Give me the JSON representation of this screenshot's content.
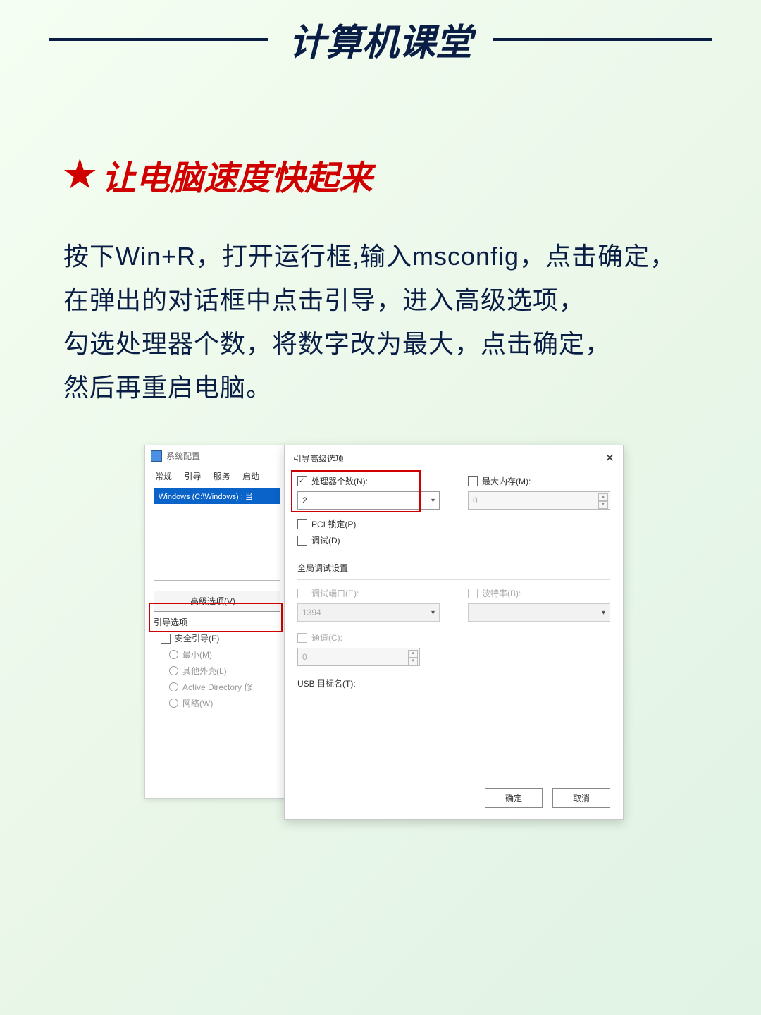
{
  "header": {
    "title": "计算机课堂"
  },
  "tip": {
    "star": "★",
    "title": "让电脑速度快起来",
    "body_line1": "按下Win+R，打开运行框,输入msconfig，点击确定，",
    "body_line2": "在弹出的对话框中点击引导，进入高级选项，",
    "body_line3": "勾选处理器个数，将数字改为最大，点击确定，",
    "body_line4": "然后再重启电脑。"
  },
  "msconfig": {
    "title": "系统配置",
    "tabs": {
      "t1": "常规",
      "t2": "引导",
      "t3": "服务",
      "t4": "启动"
    },
    "os_entry": "Windows (C:\\Windows) : 当",
    "adv_button": "高级选项(V)…",
    "boot_options_label": "引导选项",
    "safe_boot": "安全引导(F)",
    "r1": "最小(M)",
    "r2": "其他外壳(L)",
    "r3": "Active Directory 修",
    "r4": "网络(W)"
  },
  "advdlg": {
    "title": "引导高级选项",
    "proc_label": "处理器个数(N):",
    "proc_value": "2",
    "maxmem_label": "最大内存(M):",
    "maxmem_value": "0",
    "pci_lock": "PCI 锁定(P)",
    "debug": "调试(D)",
    "global_title": "全局调试设置",
    "debug_port_label": "调试端口(E):",
    "debug_port_value": "1394",
    "baud_label": "波特率(B):",
    "channel_label": "通道(C):",
    "channel_value": "0",
    "usb_label": "USB 目标名(T):",
    "ok": "确定",
    "cancel": "取消"
  }
}
